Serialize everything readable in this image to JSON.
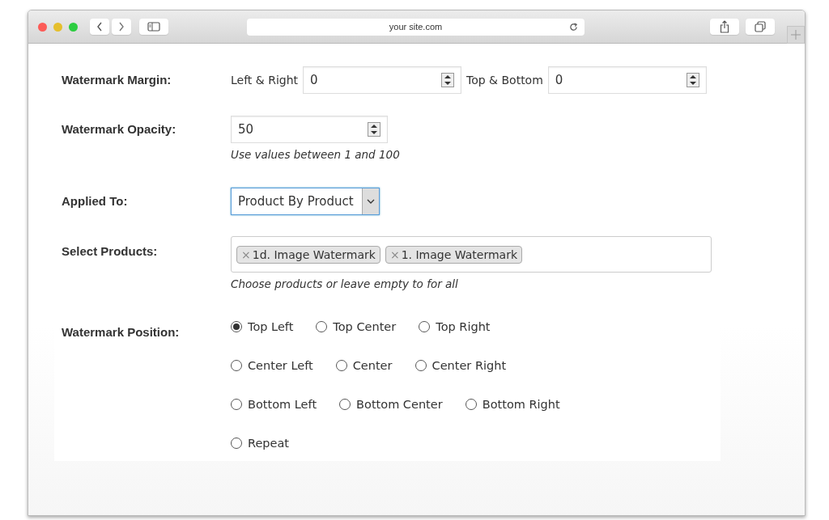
{
  "browser": {
    "address": "your site.com"
  },
  "margin": {
    "label": "Watermark Margin:",
    "fields": [
      {
        "label": "Left & Right",
        "value": "0"
      },
      {
        "label": "Top & Bottom",
        "value": "0"
      }
    ]
  },
  "opacity": {
    "label": "Watermark Opacity:",
    "value": "50",
    "hint": "Use values between 1 and 100"
  },
  "applied_to": {
    "label": "Applied To:",
    "value": "Product By Product"
  },
  "products": {
    "label": "Select Products:",
    "tags": [
      {
        "remove": "×",
        "label": "1d. Image Watermark"
      },
      {
        "remove": "×",
        "label": "1. Image Watermark"
      }
    ],
    "hint": "Choose products or leave empty to for all"
  },
  "position": {
    "label": "Watermark Position:",
    "rows": [
      {
        "options": [
          {
            "label": "Top Left",
            "selected": true
          },
          {
            "label": "Top Center",
            "selected": false
          },
          {
            "label": "Top Right",
            "selected": false
          }
        ]
      },
      {
        "options": [
          {
            "label": "Center Left",
            "selected": false
          },
          {
            "label": "Center",
            "selected": false
          },
          {
            "label": "Center Right",
            "selected": false
          }
        ]
      },
      {
        "options": [
          {
            "label": "Bottom Left",
            "selected": false
          },
          {
            "label": "Bottom Center",
            "selected": false
          },
          {
            "label": "Bottom Right",
            "selected": false
          }
        ]
      },
      {
        "options": [
          {
            "label": "Repeat",
            "selected": false
          }
        ]
      }
    ]
  }
}
